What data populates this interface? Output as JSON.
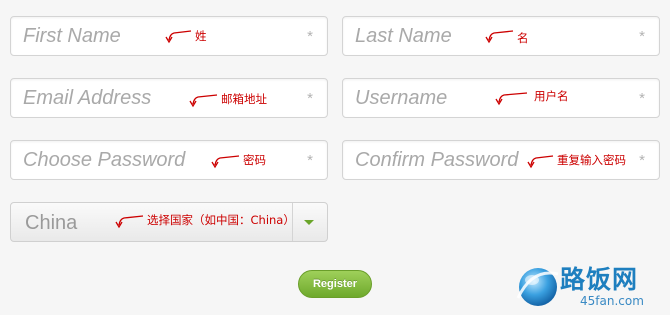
{
  "form": {
    "first_name": {
      "placeholder": "First Name",
      "required_mark": "*"
    },
    "last_name": {
      "placeholder": "Last Name",
      "required_mark": "*"
    },
    "email": {
      "placeholder": "Email Address",
      "required_mark": "*"
    },
    "username": {
      "placeholder": "Username",
      "required_mark": "*"
    },
    "password": {
      "placeholder": "Choose Password",
      "required_mark": "*"
    },
    "confirm_password": {
      "placeholder": "Confirm Password",
      "required_mark": "*"
    },
    "country": {
      "selected": "China"
    },
    "register_label": "Register"
  },
  "annotations": {
    "first_name": "姓",
    "last_name": "名",
    "email": "邮箱地址",
    "username": "用户名",
    "password": "密码",
    "confirm_password": "重复输入密码",
    "country": "选择国家（如中国：China）"
  },
  "watermark": {
    "title": "路饭网",
    "subtitle": "45fan.com"
  },
  "colors": {
    "annotation": "#cc0000",
    "button": "#7fba3a",
    "logo": "#1e7fbf"
  }
}
